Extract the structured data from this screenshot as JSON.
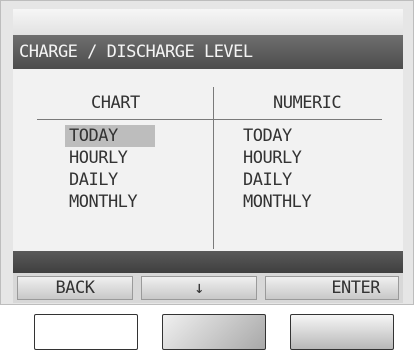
{
  "title": "CHARGE / DISCHARGE LEVEL",
  "columns": {
    "chart": {
      "header": "CHART",
      "items": [
        "TODAY",
        "HOURLY",
        "DAILY",
        "MONTHLY"
      ],
      "selected_index": 0
    },
    "numeric": {
      "header": "NUMERIC",
      "items": [
        "TODAY",
        "HOURLY",
        "DAILY",
        "MONTHLY"
      ]
    }
  },
  "softkeys": {
    "back": "BACK",
    "down": "↓",
    "enter": "ENTER"
  }
}
